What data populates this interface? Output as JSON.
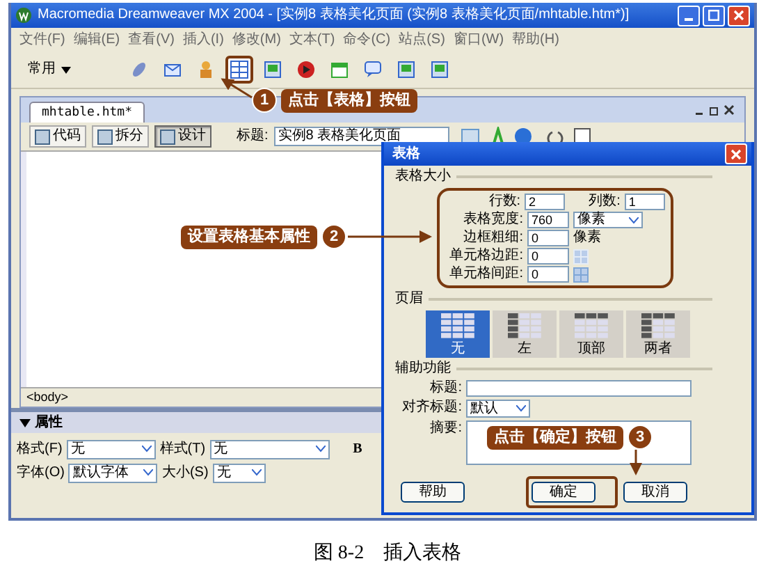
{
  "window": {
    "title": "Macromedia Dreamweaver MX 2004 - [实例8 表格美化页面 (实例8    表格美化页面/mhtable.htm*)]"
  },
  "menu": [
    "文件(F)",
    "编辑(E)",
    "查看(V)",
    "插入(I)",
    "修改(M)",
    "文本(T)",
    "命令(C)",
    "站点(S)",
    "窗口(W)",
    "帮助(H)"
  ],
  "insert_bar": {
    "category": "常用"
  },
  "document": {
    "tab": "mhtable.htm*",
    "view_buttons": [
      {
        "label": "代码",
        "selected": false
      },
      {
        "label": "拆分",
        "selected": false
      },
      {
        "label": "设计",
        "selected": true
      }
    ],
    "title_label": "标题:",
    "title_value": "实例8  表格美化页面",
    "status": "<body>"
  },
  "properties": {
    "header": "属性",
    "expanded": true,
    "format_label": "格式(F)",
    "format_value": "无",
    "style_label": "样式(T)",
    "style_value": "无",
    "bold": "B",
    "font_label": "字体(O)",
    "font_value": "默认字体",
    "size_label": "大小(S)",
    "size_value": "无"
  },
  "dialog": {
    "title": "表格",
    "size_section": "表格大小",
    "fields": [
      {
        "kind": "double",
        "label": "行数:",
        "value": "2",
        "label2": "列数:",
        "value2": "1"
      },
      {
        "kind": "select",
        "label": "表格宽度:",
        "value": "760",
        "unit": "像素"
      },
      {
        "kind": "unit",
        "label": "边框粗细:",
        "value": "0",
        "unit": "像素"
      },
      {
        "kind": "padding",
        "label": "单元格边距:",
        "value": "0"
      },
      {
        "kind": "spacing",
        "label": "单元格间距:",
        "value": "0"
      }
    ],
    "header_section": "页眉",
    "header_options": [
      {
        "label": "无",
        "kind": "none",
        "selected": true
      },
      {
        "label": "左",
        "kind": "left",
        "selected": false
      },
      {
        "label": "顶部",
        "kind": "top",
        "selected": false
      },
      {
        "label": "两者",
        "kind": "both",
        "selected": false
      }
    ],
    "access_section": "辅助功能",
    "caption_label": "标题:",
    "align_label": "对齐标题:",
    "align_value": "默认",
    "summary_label": "摘要:",
    "buttons": [
      "帮助",
      "确定",
      "取消"
    ]
  },
  "callouts": [
    {
      "number": "1",
      "text": "点击【表格】按钮"
    },
    {
      "number": "2",
      "text": "设置表格基本属性"
    },
    {
      "number": "3",
      "text": "点击【确定】按钮"
    }
  ],
  "caption": {
    "figure": "图 8-2",
    "text": "插入表格"
  }
}
